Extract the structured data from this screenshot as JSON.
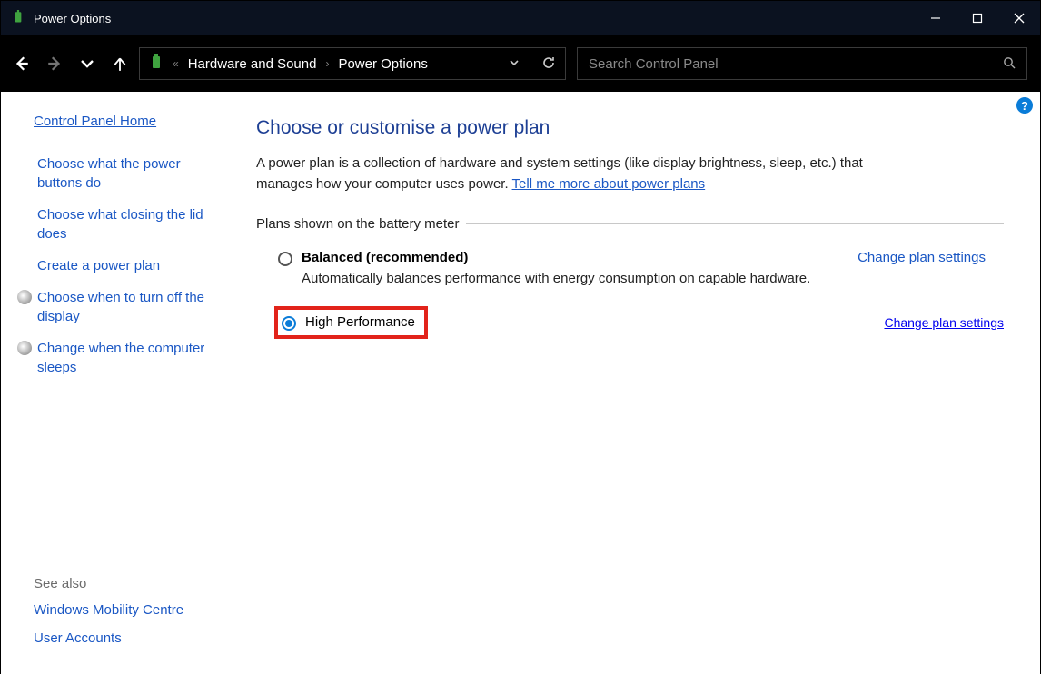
{
  "window": {
    "title": "Power Options"
  },
  "breadcrumb": {
    "parent": "Hardware and Sound",
    "current": "Power Options"
  },
  "search": {
    "placeholder": "Search Control Panel"
  },
  "sidebar": {
    "home": "Control Panel Home",
    "links": [
      {
        "label": "Choose what the power buttons do",
        "has_icon": false
      },
      {
        "label": "Choose what closing the lid does",
        "has_icon": false
      },
      {
        "label": "Create a power plan",
        "has_icon": false
      },
      {
        "label": "Choose when to turn off the display",
        "has_icon": true
      },
      {
        "label": "Change when the computer sleeps",
        "has_icon": true
      }
    ],
    "see_also_title": "See also",
    "see_also": [
      "Windows Mobility Centre",
      "User Accounts"
    ]
  },
  "main": {
    "heading": "Choose or customise a power plan",
    "intro_text": "A power plan is a collection of hardware and system settings (like display brightness, sleep, etc.) that manages how your computer uses power. ",
    "intro_link": "Tell me more about power plans",
    "section_label": "Plans shown on the battery meter",
    "plans": [
      {
        "name": "Balanced (recommended)",
        "description": "Automatically balances performance with energy consumption on capable hardware.",
        "selected": false,
        "change_label": "Change plan settings"
      },
      {
        "name": "High Performance",
        "description": "",
        "selected": true,
        "change_label": "Change plan settings"
      }
    ]
  },
  "help_badge": "?"
}
